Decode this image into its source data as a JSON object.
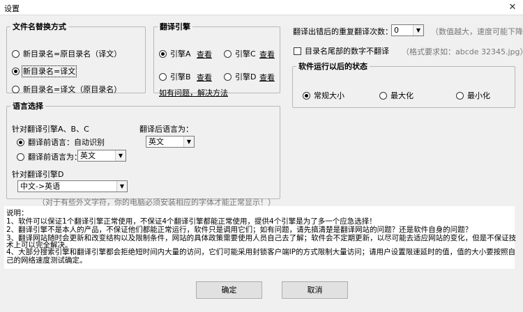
{
  "window": {
    "title": "设置",
    "close_glyph": "✕"
  },
  "rename": {
    "legend": "文件名替换方式",
    "options": [
      {
        "label": "新目录名=原目录名（译文）",
        "selected": false
      },
      {
        "label": "新目录名=译文",
        "selected": true
      },
      {
        "label": "新目录名=译文（原目录名）",
        "selected": false
      }
    ]
  },
  "engine": {
    "legend": "翻译引擎",
    "options": [
      {
        "label": "引擎A",
        "view": "查看",
        "selected": true
      },
      {
        "label": "引擎C",
        "view": "查看",
        "selected": false
      },
      {
        "label": "引擎B",
        "view": "查看",
        "selected": false
      },
      {
        "label": "引擎D",
        "view": "查看",
        "selected": false
      }
    ],
    "help_link": "如有问题，解决方法"
  },
  "retry": {
    "label": "翻译出错后的重复翻译次数：",
    "value": "0",
    "hint": "（数值越大，速度可能下降）"
  },
  "trailing_digits": {
    "label": "目录名尾部的数字不翻译",
    "checked": false,
    "hint": "（格式要求如：abcde 32345.jpg）"
  },
  "window_state": {
    "legend": "软件运行以后的状态",
    "options": [
      {
        "label": "常规大小",
        "selected": true
      },
      {
        "label": "最大化",
        "selected": false
      },
      {
        "label": "最小化",
        "selected": false
      }
    ]
  },
  "language": {
    "legend": "语言选择",
    "abc_label": "针对翻译引擎A、B、C",
    "source_auto": {
      "label": "翻译前语言：自动识别",
      "selected": true
    },
    "source_manual": {
      "label": "翻译前语言为：",
      "selected": false,
      "value": "英文"
    },
    "target_label": "翻译后语言为：",
    "target_value": "英文",
    "d_label": "针对翻译引擎D",
    "d_value": "中文->英语",
    "font_hint": "（对于有些外文字符，你的电脑必须安装相应的字体才能正常显示！）"
  },
  "description": {
    "lines": [
      "说明：",
      "1、软件可以保证1个翻译引擎正常使用，不保证4个翻译引擎都能正常使用，提供4个引擎是为了多一个应急选择！",
      "2、翻译引擎不是本人的产品，不保证他们都能正常运行，软件只是调用它们；如有问题，请先搞清楚是翻译网站的问题？还是软件自身的问题？",
      "3、翻译网站随时会更新和改变结构以及限制条件，网站的具体政策需要使用人员自己去了解；软件会不定期更新，以尽可能去适应网站的变化，但是不保证技",
      "术上可以完全解决。",
      "4、大部分搜索引擎和翻译引擎都会拒绝短时间内大量的访问，它们可能采用封锁客户端IP的方式限制大量访问；请用户设置限速延时的值，值的大小要按照自",
      "己的网络速度测试确定。"
    ]
  },
  "buttons": {
    "ok": "确定",
    "cancel": "取消"
  }
}
